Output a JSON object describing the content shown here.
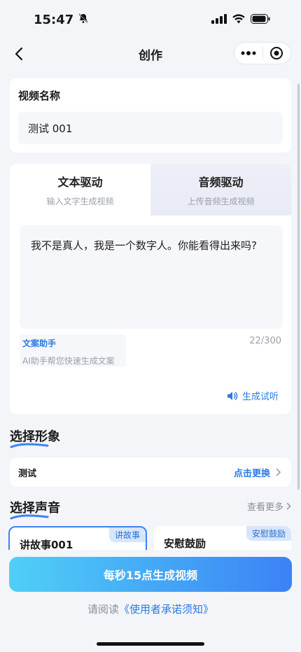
{
  "status_bar": {
    "time": "15:47"
  },
  "nav": {
    "title": "创作"
  },
  "video_name": {
    "label": "视频名称",
    "value": "测试 001"
  },
  "drive_tabs": [
    {
      "title": "文本驱动",
      "subtitle": "输入文字生成视频"
    },
    {
      "title": "音频驱动",
      "subtitle": "上传音频生成视频"
    }
  ],
  "script_text": "我不是真人，我是一个数字人。你能看得出来吗?",
  "assistant": {
    "title": "文案助手",
    "subtitle": "AI助手帮您快速生成文案"
  },
  "char_count": "22/300",
  "preview_label": "生成试听",
  "avatar_section": {
    "title": "选择形象",
    "current": "测试",
    "change_label": "点击更换"
  },
  "voice_section": {
    "title": "选择声音",
    "see_more": "查看更多",
    "voices": [
      {
        "name": "讲故事001",
        "tag": "讲故事"
      },
      {
        "name": "安慰鼓励",
        "tag": "安慰鼓励"
      }
    ]
  },
  "generate_button": "每秒15点生成视频",
  "agreement": {
    "prefix": "请阅读",
    "link": "《使用者承诺须知》"
  },
  "colors": {
    "accent": "#2a7ae4",
    "gradient_start": "#4fd0f7",
    "gradient_end": "#3b82f6",
    "background": "#f3f5f9"
  }
}
